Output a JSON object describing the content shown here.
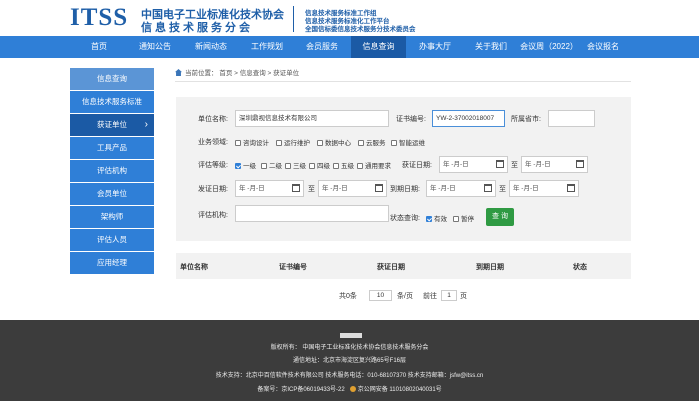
{
  "header": {
    "logo_itss": "ITSS",
    "logo_cn1": "中国电子工业标准化技术协会",
    "logo_cn2": "信息技术服务分会",
    "sub1": "信息技术服务标准工作组",
    "sub2": "信息技术服务标准化工作平台",
    "sub3": "全国信标委信息技术服务分技术委员会"
  },
  "nav": [
    "首页",
    "通知公告",
    "新闻动态",
    "工作规划",
    "会员服务",
    "信息查询",
    "办事大厅",
    "关于我们",
    "会议周（2022）",
    "会议报名"
  ],
  "sidebar": [
    "信息查询",
    "信息技术服务标准",
    "获证单位",
    "工具产品",
    "评估机构",
    "会员单位",
    "架构师",
    "评估人员",
    "应用经理"
  ],
  "breadcrumb": {
    "label": "当前位置：",
    "path": "首页 > 信息查询 > 获证单位"
  },
  "form": {
    "unit_name_label": "单位名称:",
    "unit_name_value": "深圳鼎视信息技术有限公司",
    "cert_no_label": "证书编号:",
    "cert_no_value": "YW-2-37002018007",
    "province_label": "所属省市:",
    "province_value": "",
    "domain_label": "业务领域:",
    "domains": [
      "咨询设计",
      "运行维护",
      "数据中心",
      "云服务",
      "智能运维"
    ],
    "level_label": "评估等级:",
    "levels": [
      "一级",
      "二级",
      "三级",
      "四级",
      "五级",
      "通用要求"
    ],
    "level_checked": "一级",
    "cert_date_label": "获证日期:",
    "issue_date_label": "发证日期:",
    "expire_date_label": "到期日期:",
    "date_placeholder": "年 -月-日",
    "tilde": "至",
    "org_label": "评估机构:",
    "status_label": "状态查询:",
    "status_valid": "有效",
    "status_suspend": "暂停",
    "query_button": "查 询"
  },
  "table": {
    "headers": [
      "单位名称",
      "证书编号",
      "获证日期",
      "到期日期",
      "状态"
    ]
  },
  "pager": {
    "total": "共0条",
    "page_size": "10",
    "per_page": "条/页",
    "goto": "前往",
    "page": "1",
    "page_unit": "页"
  },
  "footer": {
    "copyright": "版权所有：   中国电子工业标准化技术协会信息技术服务分会",
    "address": "通信地址：北京市海淀区复兴路65号F16层",
    "support": "技术支持：北京中百信软件技术有限公司   技术服务电话：010-68107370   技术支持邮箱：jsfw@itss.cn",
    "icp": "备案号：京ICP备06019433号-22",
    "police": "京公网安备 11010802040031号"
  }
}
